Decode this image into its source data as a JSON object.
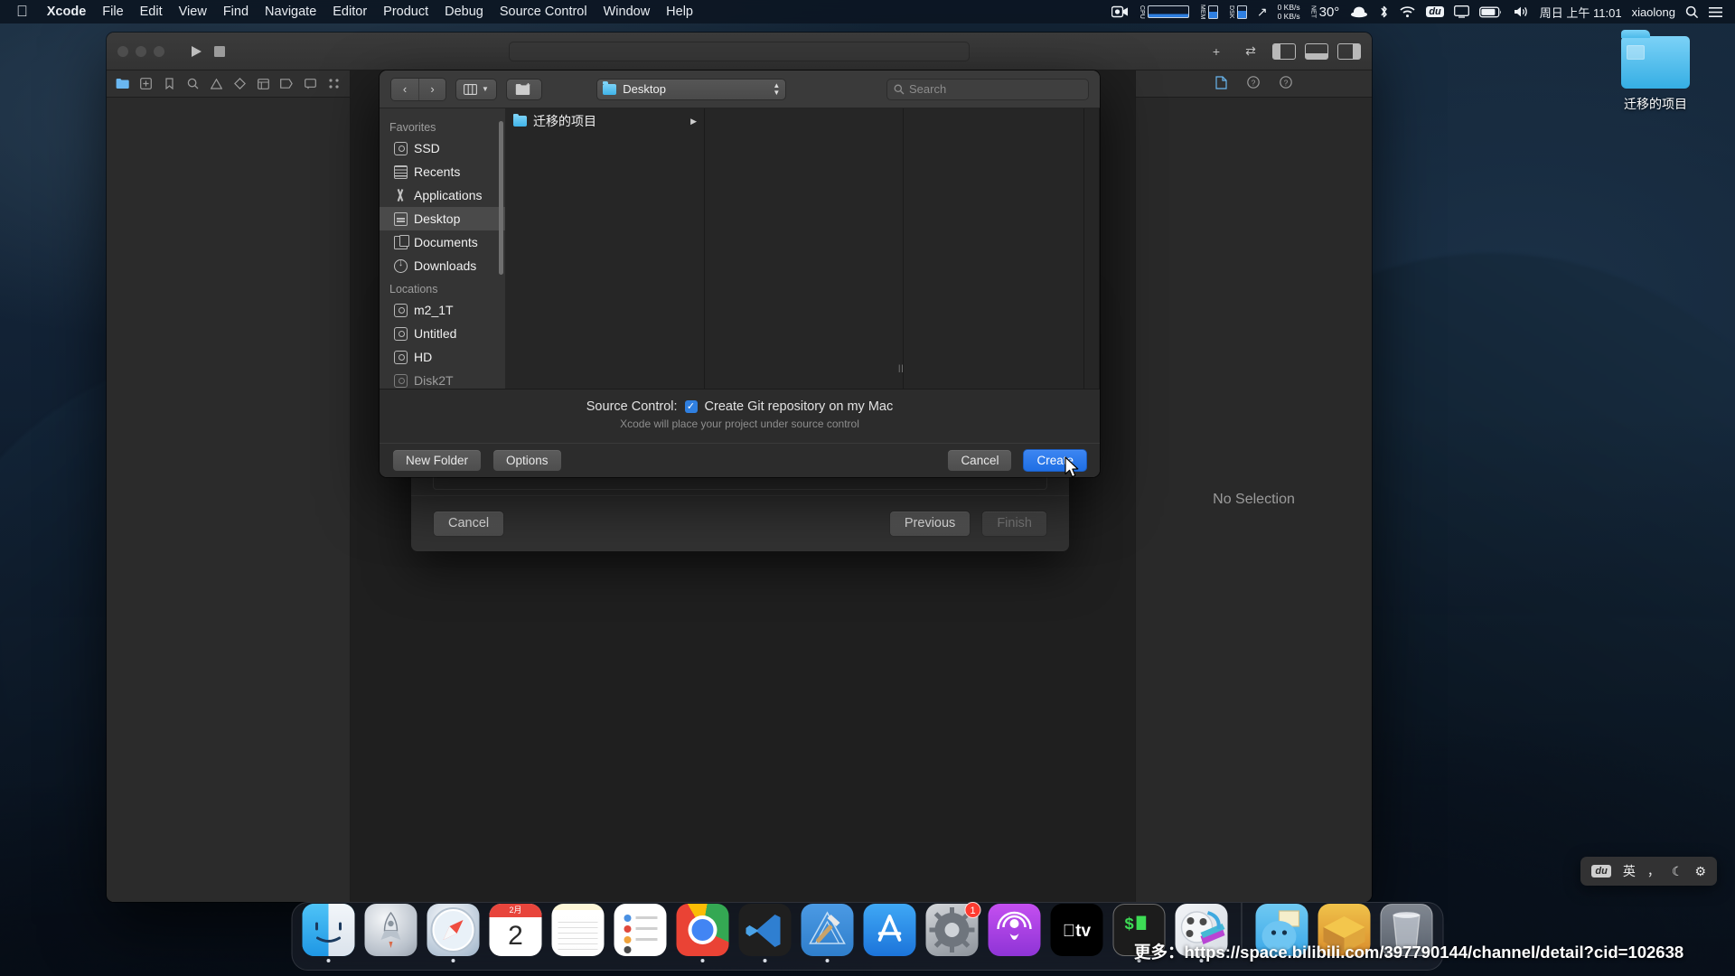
{
  "menubar": {
    "apple_icon": "apple-logo",
    "items": [
      {
        "label": "Xcode",
        "bold": true
      },
      {
        "label": "File",
        "bold": false
      },
      {
        "label": "Edit",
        "bold": false
      },
      {
        "label": "View",
        "bold": false
      },
      {
        "label": "Find",
        "bold": false
      },
      {
        "label": "Navigate",
        "bold": false
      },
      {
        "label": "Editor",
        "bold": false
      },
      {
        "label": "Product",
        "bold": false
      },
      {
        "label": "Debug",
        "bold": false
      },
      {
        "label": "Source Control",
        "bold": false
      },
      {
        "label": "Window",
        "bold": false
      },
      {
        "label": "Help",
        "bold": false
      }
    ],
    "status": {
      "cpu_label": "CPU",
      "mem_label": "MEM",
      "disk_label": "DSK",
      "net_label": "NET",
      "net_up": "0 KB/s",
      "net_down": "0 KB/s",
      "temperature": "30°",
      "ime": "du",
      "clock": "周日 上午 11:01",
      "user": "xiaolong"
    }
  },
  "desktop": {
    "icon_label": "迁移的项目"
  },
  "xcode": {
    "navigator_tabs": [
      "folder-icon",
      "grid-icon",
      "branch-icon",
      "search-icon",
      "warning-icon",
      "diamond-icon",
      "table-icon",
      "tag-icon",
      "comment-icon",
      "breakpoint-icon"
    ],
    "inspector_tabs": [
      "file-inspector-icon",
      "quick-help-icon",
      "help-icon"
    ],
    "no_selection": "No Selection"
  },
  "wizard": {
    "cancel_label": "Cancel",
    "previous_label": "Previous",
    "finish_label": "Finish"
  },
  "savepanel": {
    "nav_back": "‹",
    "nav_forward": "›",
    "view_mode_icon": "column-view-icon",
    "new_folder_icon": "new-folder-icon",
    "location": "Desktop",
    "search_placeholder": "Search",
    "search_icon": "search-icon",
    "sidebar": [
      {
        "type": "group",
        "label": "Favorites"
      },
      {
        "type": "item",
        "label": "SSD",
        "icon": "disk-icon",
        "selected": false
      },
      {
        "type": "item",
        "label": "Recents",
        "icon": "recents-icon",
        "selected": false
      },
      {
        "type": "item",
        "label": "Applications",
        "icon": "applications-icon",
        "selected": false
      },
      {
        "type": "item",
        "label": "Desktop",
        "icon": "desktop-icon",
        "selected": true
      },
      {
        "type": "item",
        "label": "Documents",
        "icon": "documents-icon",
        "selected": false
      },
      {
        "type": "item",
        "label": "Downloads",
        "icon": "downloads-icon",
        "selected": false
      },
      {
        "type": "group",
        "label": "Locations"
      },
      {
        "type": "item",
        "label": "m2_1T",
        "icon": "disk-icon",
        "selected": false
      },
      {
        "type": "item",
        "label": "Untitled",
        "icon": "disk-icon",
        "selected": false
      },
      {
        "type": "item",
        "label": "HD",
        "icon": "disk-icon",
        "selected": false
      },
      {
        "type": "item",
        "label": "Disk2T",
        "icon": "disk-icon",
        "selected": false
      }
    ],
    "column1": [
      {
        "label": "迁移的项目",
        "icon": "folder-icon",
        "has_children": true,
        "arrow": "▶"
      }
    ],
    "source_control": {
      "label": "Source Control:",
      "checkbox_checked": true,
      "checkbox_glyph": "✓",
      "checkbox_label": "Create Git repository on my Mac",
      "sublabel": "Xcode will place your project under source control"
    },
    "footer": {
      "new_folder_label": "New Folder",
      "options_label": "Options",
      "cancel_label": "Cancel",
      "create_label": "Create"
    }
  },
  "ime": {
    "logo": "du",
    "mode": "英",
    "punct": "，",
    "moon": "☾",
    "gear": "⚙"
  },
  "dock": {
    "apps": [
      {
        "name": "Finder",
        "icon": "finder-icon",
        "running": true
      },
      {
        "name": "Launchpad",
        "icon": "launchpad-icon",
        "running": false
      },
      {
        "name": "Safari",
        "icon": "safari-icon",
        "running": true
      },
      {
        "name": "Calendar",
        "icon": "calendar-icon",
        "running": false,
        "month": "2月",
        "day": "2"
      },
      {
        "name": "Notes",
        "icon": "notes-icon",
        "running": false
      },
      {
        "name": "Reminders",
        "icon": "reminders-icon",
        "running": false
      },
      {
        "name": "Google Chrome",
        "icon": "chrome-icon",
        "running": true
      },
      {
        "name": "Visual Studio Code",
        "icon": "vscode-icon",
        "running": true
      },
      {
        "name": "Xcode",
        "icon": "xcode-icon",
        "running": true
      },
      {
        "name": "App Store",
        "icon": "appstore-icon",
        "running": false
      },
      {
        "name": "System Settings",
        "icon": "settings-icon",
        "running": false,
        "badge": "1"
      },
      {
        "name": "Podcasts",
        "icon": "podcasts-icon",
        "running": false
      },
      {
        "name": "Apple TV",
        "icon": "tv-icon",
        "running": false
      },
      {
        "name": "Terminal",
        "icon": "terminal-icon",
        "running": true,
        "glyph": "$"
      },
      {
        "name": "QuickTime Player",
        "icon": "quicktime-icon",
        "running": true
      }
    ],
    "recent": [
      {
        "name": "Mail",
        "icon": "mail-icon"
      },
      {
        "name": "Archive Utility",
        "icon": "archive-icon"
      },
      {
        "name": "Trash",
        "icon": "trash-icon"
      }
    ]
  },
  "watermark": {
    "text": "更多：https://space.bilibili.com/397790144/channel/detail?cid=102638"
  }
}
